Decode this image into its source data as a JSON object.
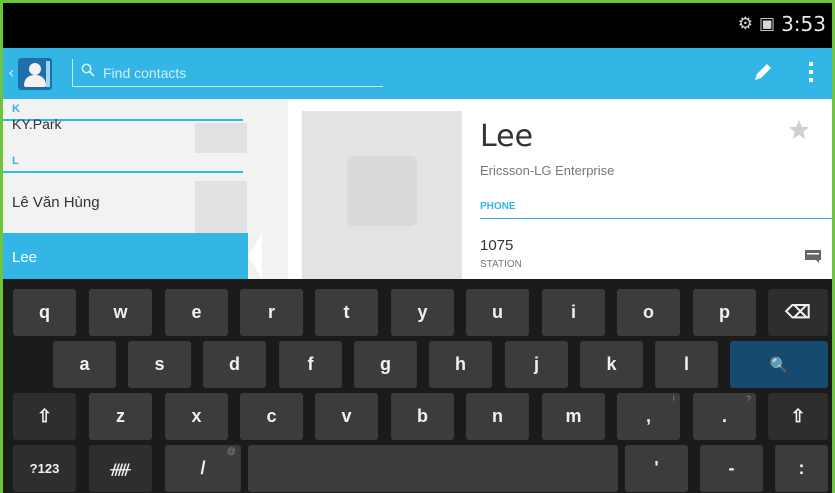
{
  "status_bar": {
    "time": "3:53",
    "icons": [
      "voice-settings-icon",
      "notification-icon"
    ]
  },
  "action_bar": {
    "search_placeholder": "Find contacts",
    "icons": [
      "contacts-app-icon",
      "search-icon",
      "edit-icon",
      "overflow-menu-icon"
    ]
  },
  "contact_list": {
    "sections": [
      {
        "letter": "K",
        "items": [
          "KY.Park"
        ]
      },
      {
        "letter": "L",
        "items": [
          "Lê Văn Hùng",
          "Lee"
        ]
      }
    ],
    "selected": "Lee"
  },
  "contact_detail": {
    "name": "Lee",
    "company": "Ericsson-LG Enterprise",
    "phone_section": "PHONE",
    "phone_number": "1075",
    "phone_type": "STATION"
  },
  "keyboard": {
    "row1": [
      "q",
      "w",
      "e",
      "r",
      "t",
      "y",
      "u",
      "i",
      "o",
      "p",
      "⌫"
    ],
    "row2": [
      "a",
      "s",
      "d",
      "f",
      "g",
      "h",
      "j",
      "k",
      "l",
      "🔍"
    ],
    "row3": [
      "⇧",
      "z",
      "x",
      "c",
      "v",
      "b",
      "n",
      "m",
      ",",
      ".",
      "⇧"
    ],
    "row3_hints": [
      "!",
      "?"
    ],
    "row4": [
      "?123",
      "ᚏ",
      "/",
      "",
      "'",
      "-",
      ":"
    ],
    "row4_hint": "@"
  }
}
